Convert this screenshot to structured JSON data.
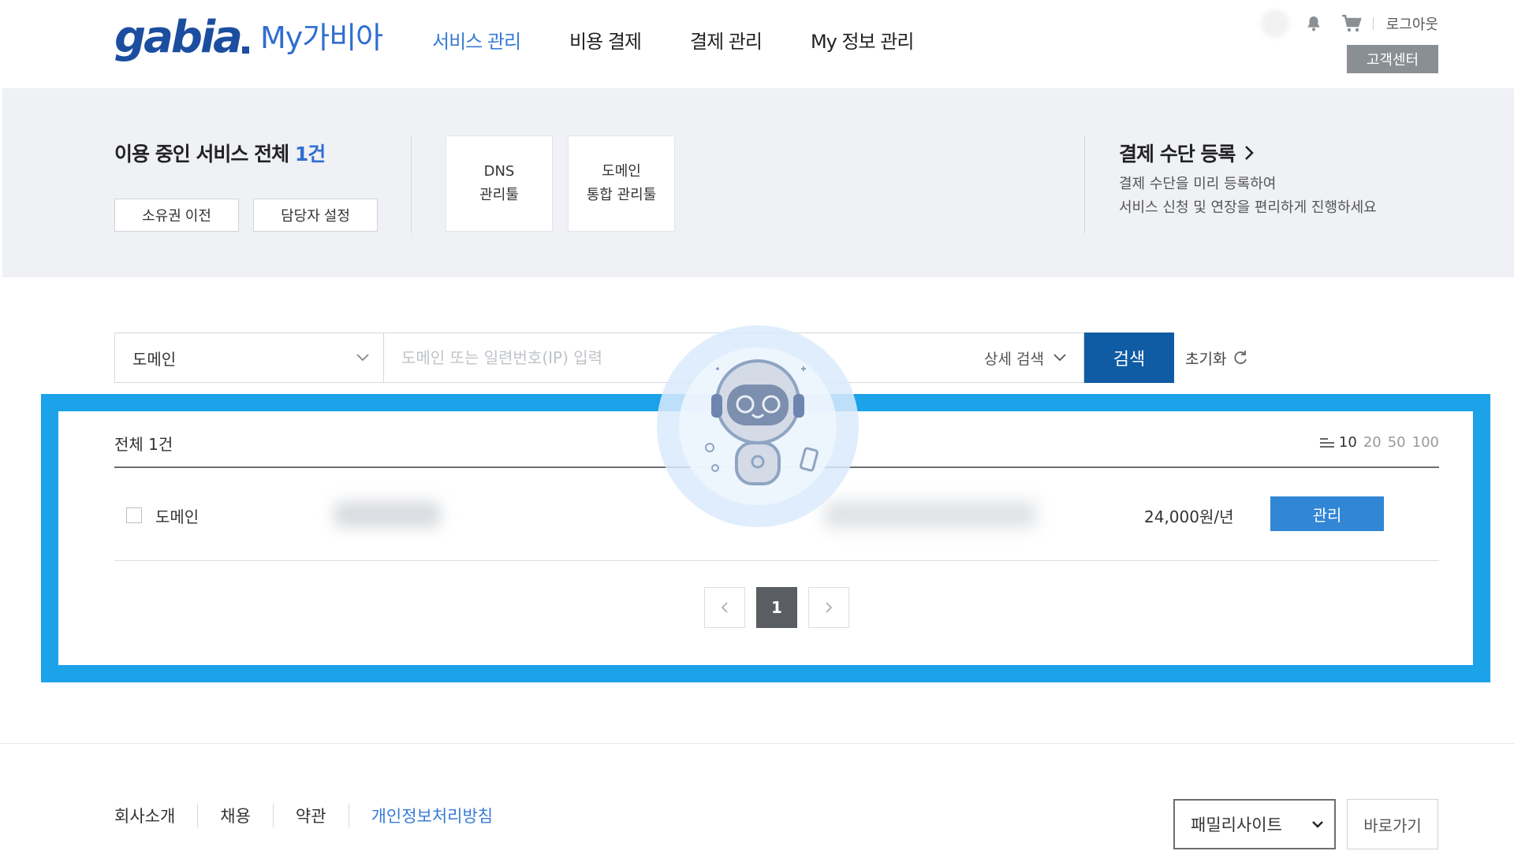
{
  "header": {
    "logo_brand": "gabia",
    "logo_sub": "My가비아",
    "nav": [
      {
        "label": "서비스 관리",
        "active": true
      },
      {
        "label": "비용 결제",
        "active": false
      },
      {
        "label": "결제 관리",
        "active": false
      },
      {
        "label": "My 정보 관리",
        "active": false
      }
    ],
    "logout_label": "로그아웃",
    "support_label": "고객센터",
    "icons": [
      "bell-icon",
      "cart-icon"
    ]
  },
  "summary": {
    "title_prefix": "이용 중인 서비스 전체 ",
    "title_count": "1건",
    "buttons": [
      "소유권 이전",
      "담당자 설정"
    ],
    "tiles": [
      {
        "line1": "DNS",
        "line2": "관리툴"
      },
      {
        "line1": "도메인",
        "line2": "통합 관리툴"
      }
    ],
    "payment": {
      "title": "결제 수단 등록",
      "desc1": "결제 수단을 미리 등록하여",
      "desc2": "서비스 신청 및 연장을 편리하게 진행하세요"
    }
  },
  "search": {
    "category": "도메인",
    "placeholder": "도메인 또는 일련번호(IP) 입력",
    "advanced_label": "상세 검색",
    "search_label": "검색",
    "reset_label": "초기화"
  },
  "list": {
    "total_label": "전체 1건",
    "page_sizes": [
      "10",
      "20",
      "50",
      "100"
    ],
    "selected_page_size": "10",
    "rows": [
      {
        "type": "도메인",
        "price": "24,000원/년",
        "action": "관리"
      }
    ],
    "pagination": {
      "current": "1",
      "prev": "‹",
      "next": "›"
    }
  },
  "footer": {
    "links": [
      "회사소개",
      "채용",
      "약관"
    ],
    "privacy": "개인정보처리방침",
    "family_select": "패밀리사이트",
    "goto_label": "바로가기"
  },
  "colors": {
    "brand": "#1c4ea0",
    "nav_active": "#3a7bd5",
    "search_button": "#0f5ba4",
    "manage_button": "#3186d6",
    "highlight_frame": "#1ba2e8",
    "summary_bg": "#eff1f5"
  }
}
